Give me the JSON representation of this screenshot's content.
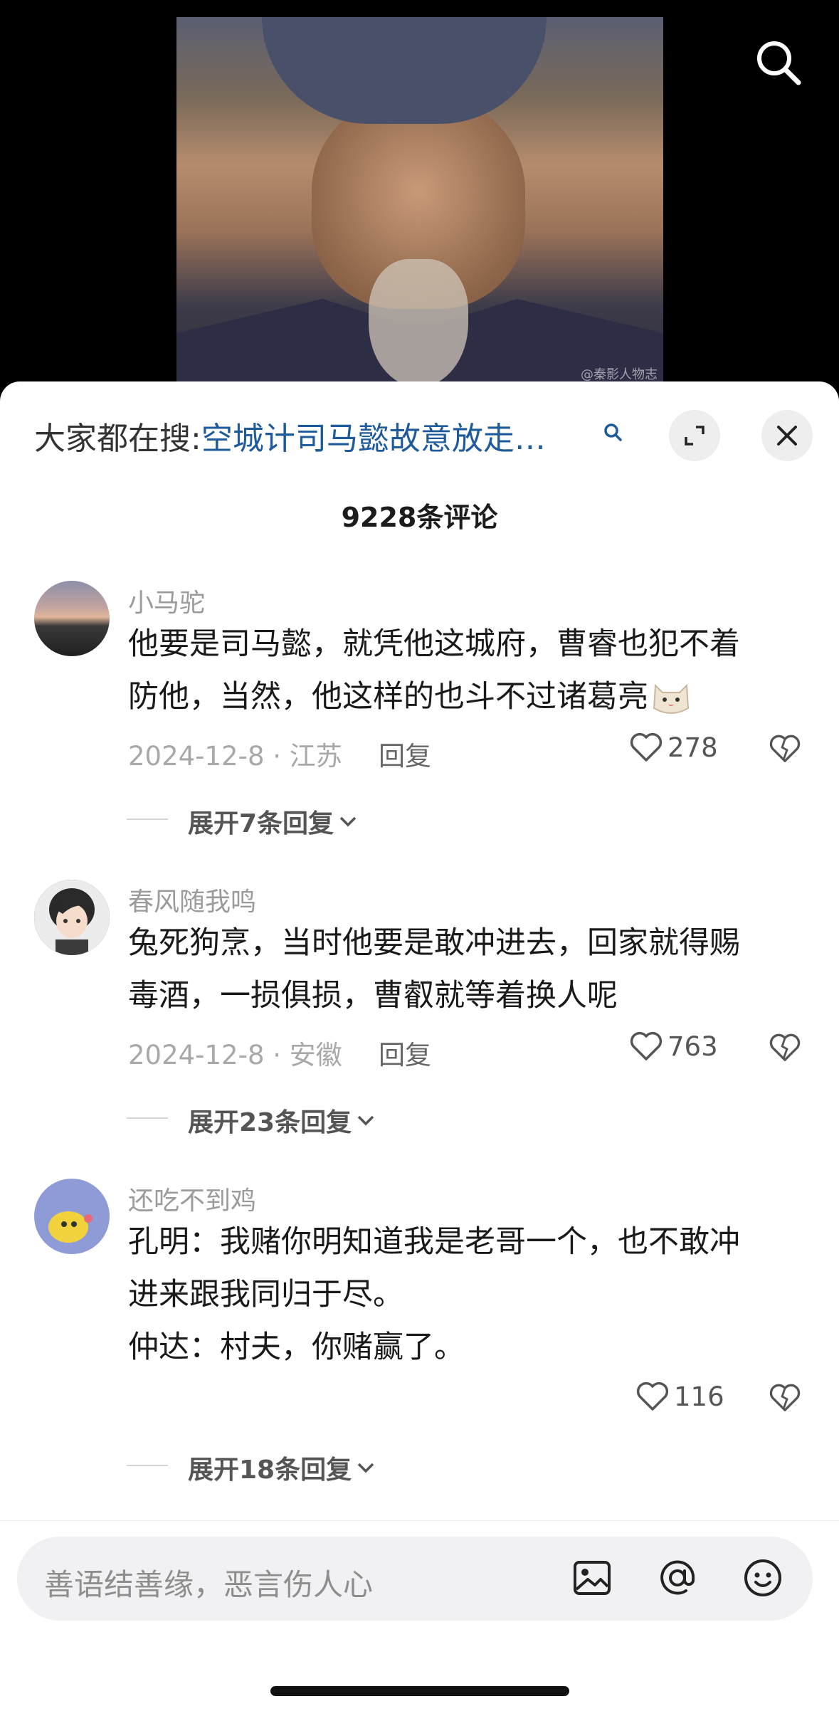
{
  "video": {
    "watermark": "@秦影人物志",
    "search_icon": "search-icon"
  },
  "panel": {
    "trending_prefix": "大家都在搜:",
    "trending_query": "空城计司马懿故意放走…",
    "comment_count": "9228条评论"
  },
  "comments": [
    {
      "username": "小马驼",
      "text_lines": [
        "他要是司马懿，就凭他这城府，曹睿也犯不着",
        "防他，当然，他这样的也斗不过诸葛亮"
      ],
      "emoji": "cat-emoji",
      "meta": "2024-12-8 · 江苏",
      "reply_label": "回复",
      "likes": "278",
      "expand_label": "展开7条回复"
    },
    {
      "username": "春风随我鸣",
      "text_lines": [
        "兔死狗烹，当时他要是敢冲进去，回家就得赐",
        "毒酒，一损俱损，曹叡就等着换人呢"
      ],
      "meta": "2024-12-8 · 安徽",
      "reply_label": "回复",
      "likes": "763",
      "expand_label": "展开23条回复"
    },
    {
      "username": "还吃不到鸡",
      "text_lines": [
        "孔明：我赌你明知道我是老哥一个，也不敢冲",
        "进来跟我同归于尽。",
        "仲达：村夫，你赌赢了。"
      ],
      "likes": "116",
      "expand_label": "展开18条回复"
    }
  ],
  "composer": {
    "placeholder": "善语结善缘，恶言伤人心"
  }
}
